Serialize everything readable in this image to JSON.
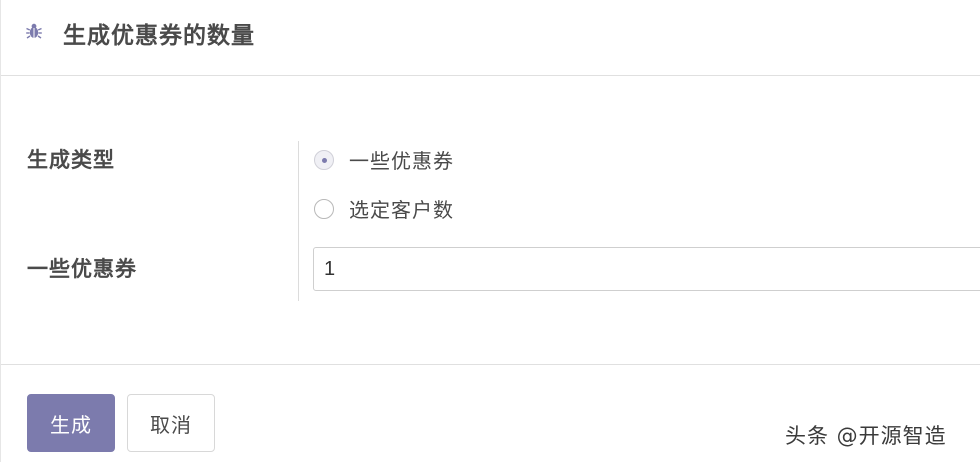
{
  "dialog": {
    "title": "生成优惠券的数量",
    "title_icon": "bug-icon"
  },
  "form": {
    "generation_type_label": "生成类型",
    "options": [
      {
        "label": "一些优惠券",
        "checked": true
      },
      {
        "label": "选定客户数",
        "checked": false
      }
    ],
    "coupon_count_label": "一些优惠券",
    "coupon_count_value": "1"
  },
  "footer": {
    "generate_label": "生成",
    "cancel_label": "取消"
  },
  "watermark": "头条 @开源智造",
  "colors": {
    "primary": "#7c7bad",
    "border": "#e0e0e0",
    "text": "#4a4a4a"
  }
}
